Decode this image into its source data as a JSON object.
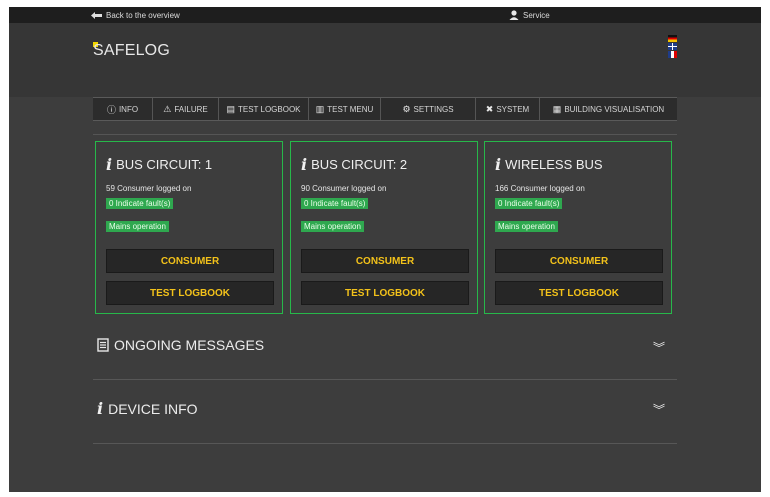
{
  "topbar": {
    "back_label": "Back to the overview",
    "service_label": "Service"
  },
  "header": {
    "logo": "SAFELOG",
    "languages": [
      "de",
      "en",
      "fr"
    ]
  },
  "nav": {
    "items": [
      {
        "label": "INFO",
        "icon": "info-circle-icon"
      },
      {
        "label": "FAILURE",
        "icon": "warning-icon"
      },
      {
        "label": "TEST LOGBOOK",
        "icon": "logbook-icon"
      },
      {
        "label": "TEST MENU",
        "icon": "test-menu-icon"
      },
      {
        "label": "SETTINGS",
        "icon": "gear-icon"
      },
      {
        "label": "SYSTEM",
        "icon": "tools-icon"
      },
      {
        "label": "BUILDING VISUALISATION",
        "icon": "building-icon"
      }
    ]
  },
  "cards": [
    {
      "title": "BUS CIRCUIT: 1",
      "consumers": "59 Consumer logged on",
      "faults": "0 Indicate fault(s)",
      "status": "Mains operation",
      "consumer_btn": "CONSUMER",
      "logbook_btn": "TEST LOGBOOK"
    },
    {
      "title": "BUS CIRCUIT: 2",
      "consumers": "90 Consumer logged on",
      "faults": "0 Indicate fault(s)",
      "status": "Mains operation",
      "consumer_btn": "CONSUMER",
      "logbook_btn": "TEST LOGBOOK"
    },
    {
      "title": "WIRELESS BUS",
      "consumers": "166 Consumer logged on",
      "faults": "0 Indicate fault(s)",
      "status": "Mains operation",
      "consumer_btn": "CONSUMER",
      "logbook_btn": "TEST LOGBOOK"
    }
  ],
  "sections": {
    "ongoing": {
      "label": "ONGOING MESSAGES",
      "icon": "messages-icon"
    },
    "device": {
      "label": "DEVICE INFO",
      "icon": "info-icon"
    }
  },
  "colors": {
    "accent": "#f3c21a",
    "card_border": "#27b84a",
    "badge": "#2fa84f",
    "background": "#3d3d3d"
  }
}
